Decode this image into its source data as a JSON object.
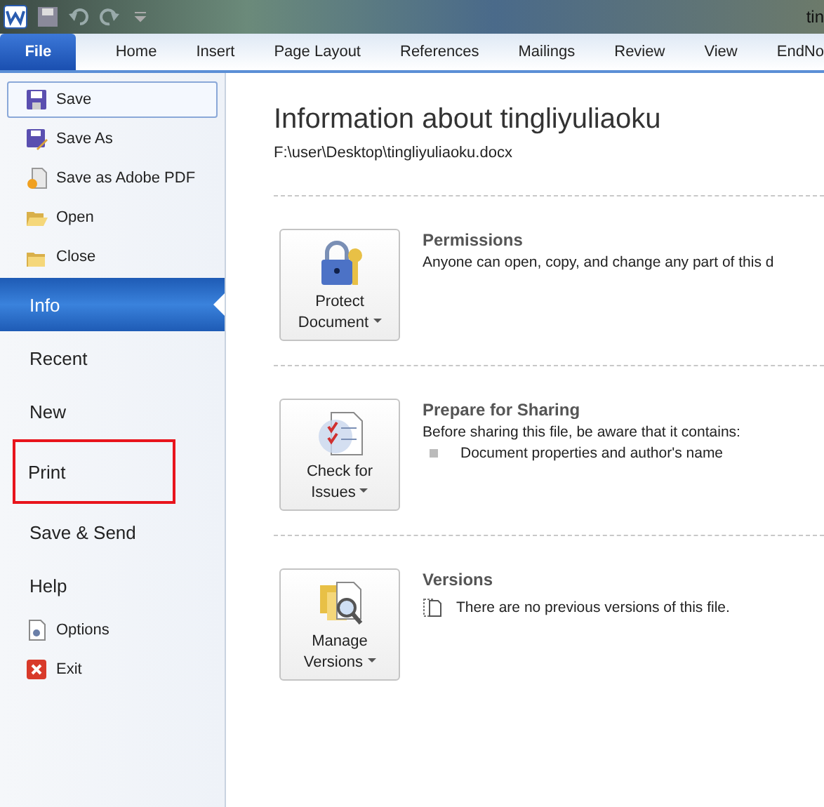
{
  "window": {
    "title": "tin"
  },
  "tabs": [
    {
      "label": "File",
      "selected": true
    },
    {
      "label": "Home",
      "selected": false
    },
    {
      "label": "Insert",
      "selected": false
    },
    {
      "label": "Page Layout",
      "selected": false
    },
    {
      "label": "References",
      "selected": false
    },
    {
      "label": "Mailings",
      "selected": false
    },
    {
      "label": "Review",
      "selected": false
    },
    {
      "label": "View",
      "selected": false
    },
    {
      "label": "EndNo",
      "selected": false
    }
  ],
  "sidebar": {
    "items": [
      {
        "kind": "command",
        "label": "Save",
        "selected": false,
        "focused": true,
        "annotated": false
      },
      {
        "kind": "command",
        "label": "Save As",
        "selected": false,
        "focused": false,
        "annotated": false
      },
      {
        "kind": "command",
        "label": "Save as Adobe PDF",
        "selected": false,
        "focused": false,
        "annotated": false
      },
      {
        "kind": "command",
        "label": "Open",
        "selected": false,
        "focused": false,
        "annotated": false
      },
      {
        "kind": "command",
        "label": "Close",
        "selected": false,
        "focused": false,
        "annotated": false
      },
      {
        "kind": "page",
        "label": "Info",
        "selected": true,
        "focused": false,
        "annotated": false
      },
      {
        "kind": "page",
        "label": "Recent",
        "selected": false,
        "focused": false,
        "annotated": false
      },
      {
        "kind": "page",
        "label": "New",
        "selected": false,
        "focused": false,
        "annotated": false
      },
      {
        "kind": "page",
        "label": "Print",
        "selected": false,
        "focused": false,
        "annotated": true
      },
      {
        "kind": "page",
        "label": "Save & Send",
        "selected": false,
        "focused": false,
        "annotated": false
      },
      {
        "kind": "page",
        "label": "Help",
        "selected": false,
        "focused": false,
        "annotated": false
      },
      {
        "kind": "command",
        "label": "Options",
        "selected": false,
        "focused": false,
        "annotated": false
      },
      {
        "kind": "command",
        "label": "Exit",
        "selected": false,
        "focused": false,
        "annotated": false
      }
    ]
  },
  "info": {
    "title": "Information about tingliyuliaoku",
    "path": "F:\\user\\Desktop\\tingliyuliaoku.docx",
    "sections": [
      {
        "button": [
          "Protect",
          "Document"
        ],
        "heading": "Permissions",
        "text": "Anyone can open, copy, and change any part of this d"
      },
      {
        "button": [
          "Check for",
          "Issues"
        ],
        "heading": "Prepare for Sharing",
        "text": "Before sharing this file, be aware that it contains:",
        "bullets": [
          "Document properties and author's name"
        ]
      },
      {
        "button": [
          "Manage",
          "Versions"
        ],
        "heading": "Versions",
        "note": "There are no previous versions of this file."
      }
    ]
  }
}
